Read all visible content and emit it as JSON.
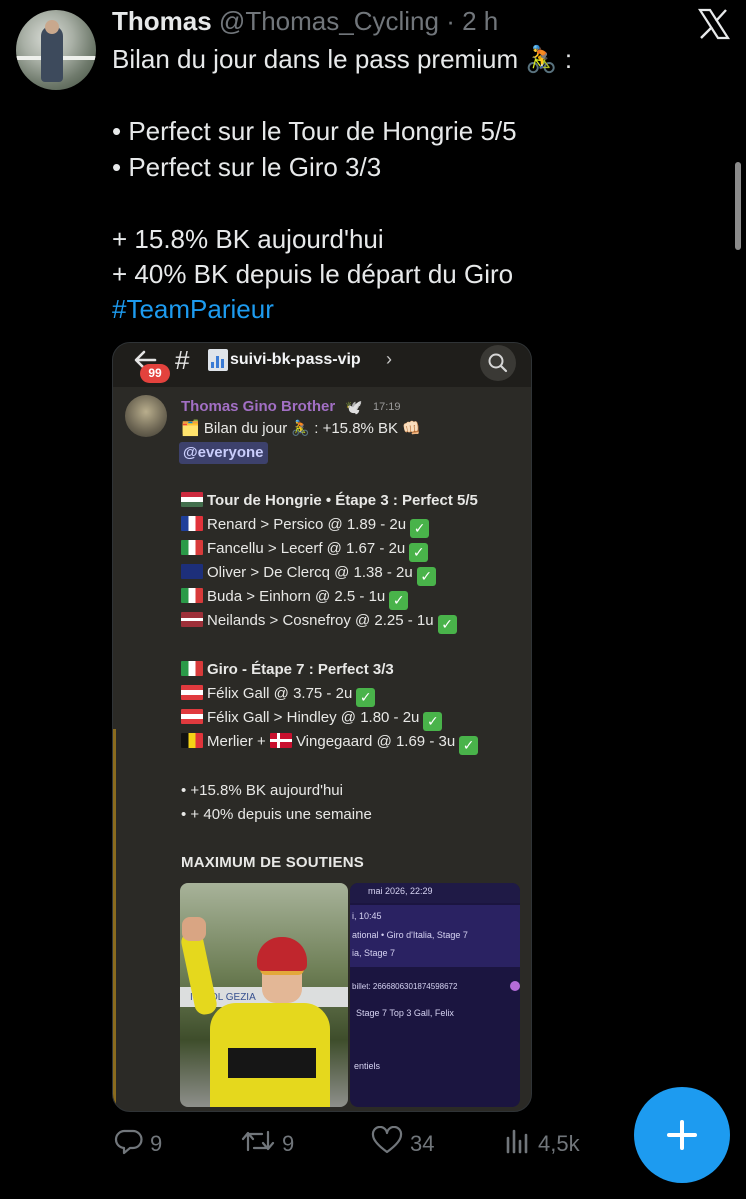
{
  "tweet": {
    "author_name": "Thomas",
    "author_handle": "@Thomas_Cycling",
    "time": "· 2 h",
    "lines": [
      "Bilan du jour dans le pass premium 🚴 :",
      "• Perfect sur le Tour de Hongrie 5/5",
      "• Perfect sur le Giro 3/3",
      "+ 15.8% BK aujourd'hui",
      "+ 40% BK depuis le départ du Giro"
    ],
    "hashtag": "#TeamParieur"
  },
  "discord": {
    "badge_count": "99",
    "channel_hash": "#",
    "channel_name": "suivi-bk-pass-vip",
    "chevron": "›",
    "author": "Thomas Gino Brother",
    "author_icon": "🕊️",
    "time": "17:19",
    "title_line": "🗂️ Bilan du jour 🚴 :  +15.8% BK 👊🏻",
    "mention": "@everyone",
    "hongrie_header": "Tour de Hongrie • Étape 3 : Perfect 5/5",
    "hongrie_bets": [
      "Renard > Persico @ 1.89 - 2u",
      "Fancellu > Lecerf @ 1.67 - 2u",
      "Oliver > De Clercq @ 1.38 - 2u",
      "Buda > Einhorn @ 2.5 - 1u",
      "Neilands > Cosnefroy @ 2.25 - 1u"
    ],
    "giro_header": "Giro - Étape 7 : Perfect 3/3",
    "giro_bets": [
      "Félix Gall @ 3.75 - 2u",
      "Félix Gall > Hindley @ 1.80 - 2u",
      "Merlier + ",
      "Vingegaard @ 1.69 - 3u"
    ],
    "summary": [
      "• +15.8% BK aujourd'hui",
      "• + 40% depuis une semaine"
    ],
    "section_title": "MAXIMUM DE SOUTIENS",
    "screenshot_lines": [
      "mai 2026, 22:29",
      "i, 10:45",
      "ational • Giro d'Italia, Stage 7",
      "ia, Stage 7",
      "billet: 2666806301874598672",
      "Stage 7 Top 3 Gall, Felix",
      "entiels"
    ],
    "photo_banner": "IO SOL    GEZIA"
  },
  "actions": {
    "replies": "9",
    "reposts": "9",
    "likes": "34",
    "views": "4,5k"
  },
  "colors": {
    "accent": "#1d9bf0",
    "muted": "#71767b",
    "discord_author": "#a26fc4",
    "check_green": "#49b34a"
  }
}
